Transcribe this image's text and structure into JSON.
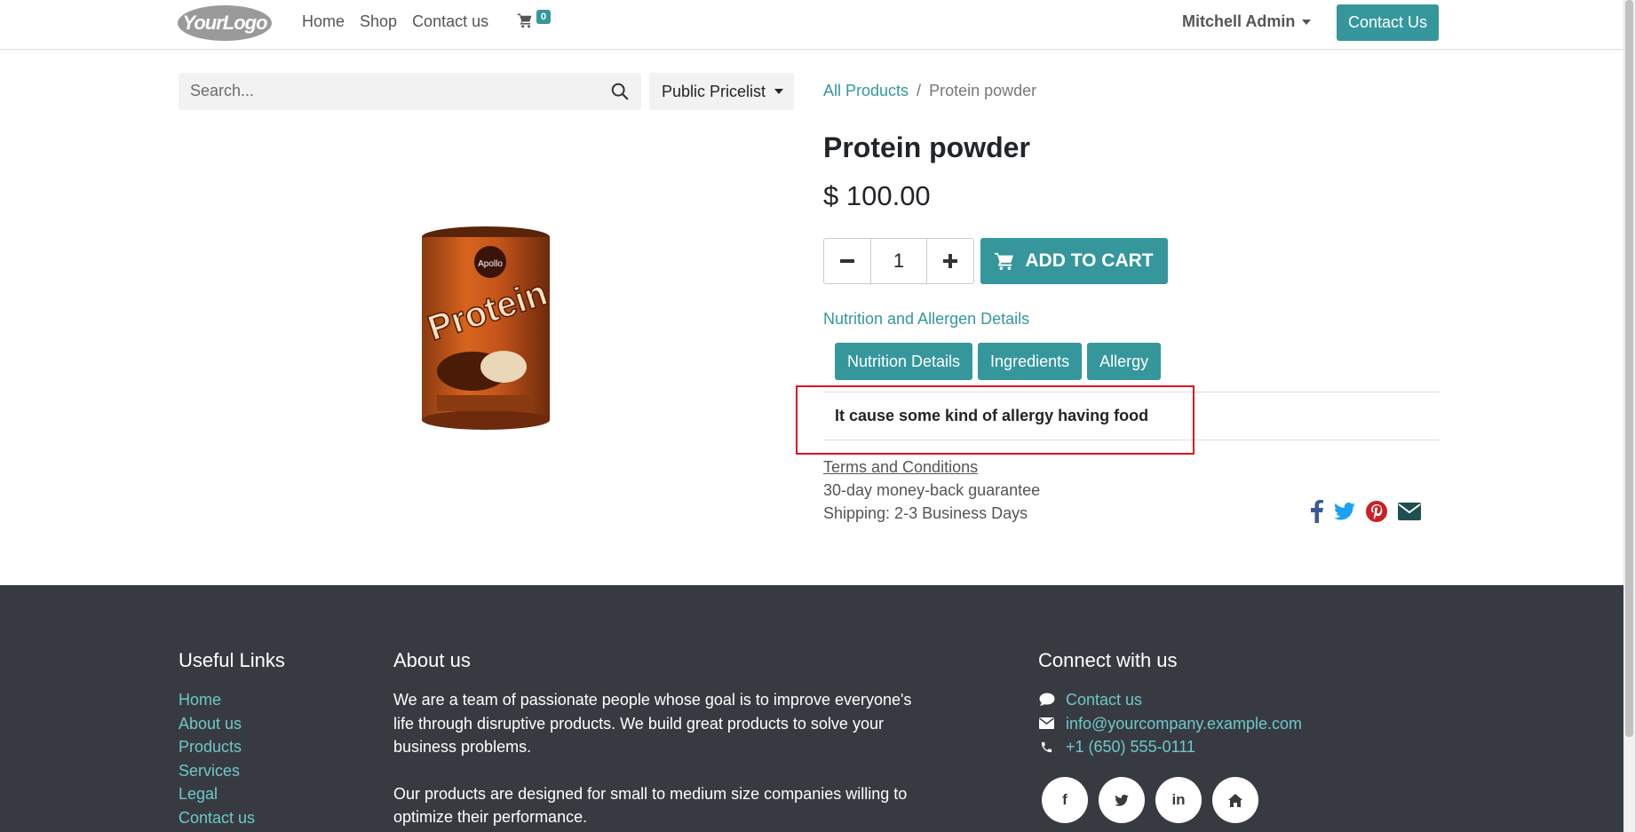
{
  "header": {
    "logo_text": "YourLogo",
    "nav": [
      "Home",
      "Shop",
      "Contact us"
    ],
    "cart_count": "0",
    "user": "Mitchell Admin",
    "contact_button": "Contact Us"
  },
  "search": {
    "placeholder": "Search...",
    "pricelist": "Public Pricelist"
  },
  "breadcrumb": {
    "parent": "All Products",
    "separator": "/",
    "current": "Protein powder"
  },
  "product": {
    "title": "Protein powder",
    "price": "$ 100.00",
    "quantity": "1",
    "add_to_cart": "ADD TO CART",
    "details_link": "Nutrition and Allergen Details",
    "tabs": [
      "Nutrition Details",
      "Ingredients",
      "Allergy"
    ],
    "tab_content": "It cause some kind of allergy having food",
    "terms": "Terms and Conditions",
    "guarantee": "30-day money-back guarantee",
    "shipping": "Shipping: 2-3 Business Days"
  },
  "share_icons": [
    "facebook-icon",
    "twitter-icon",
    "pinterest-icon",
    "envelope-icon"
  ],
  "footer": {
    "useful_links_title": "Useful Links",
    "useful_links": [
      "Home",
      "About us",
      "Products",
      "Services",
      "Legal",
      "Contact us"
    ],
    "about_title": "About us",
    "about_p1": "We are a team of passionate people whose goal is to improve everyone's life through disruptive products. We build great products to solve your business problems.",
    "about_p2": "Our products are designed for small to medium size companies willing to optimize their performance.",
    "connect_title": "Connect with us",
    "contact_link": "Contact us",
    "email": "info@yourcompany.example.com",
    "phone": "+1 (650) 555-0111",
    "social": [
      "f",
      "t",
      "in",
      "home"
    ]
  },
  "colors": {
    "accent": "#35979c",
    "footer_bg": "#373b41",
    "highlight": "#e0141e",
    "link_light": "#6fc7cb"
  }
}
